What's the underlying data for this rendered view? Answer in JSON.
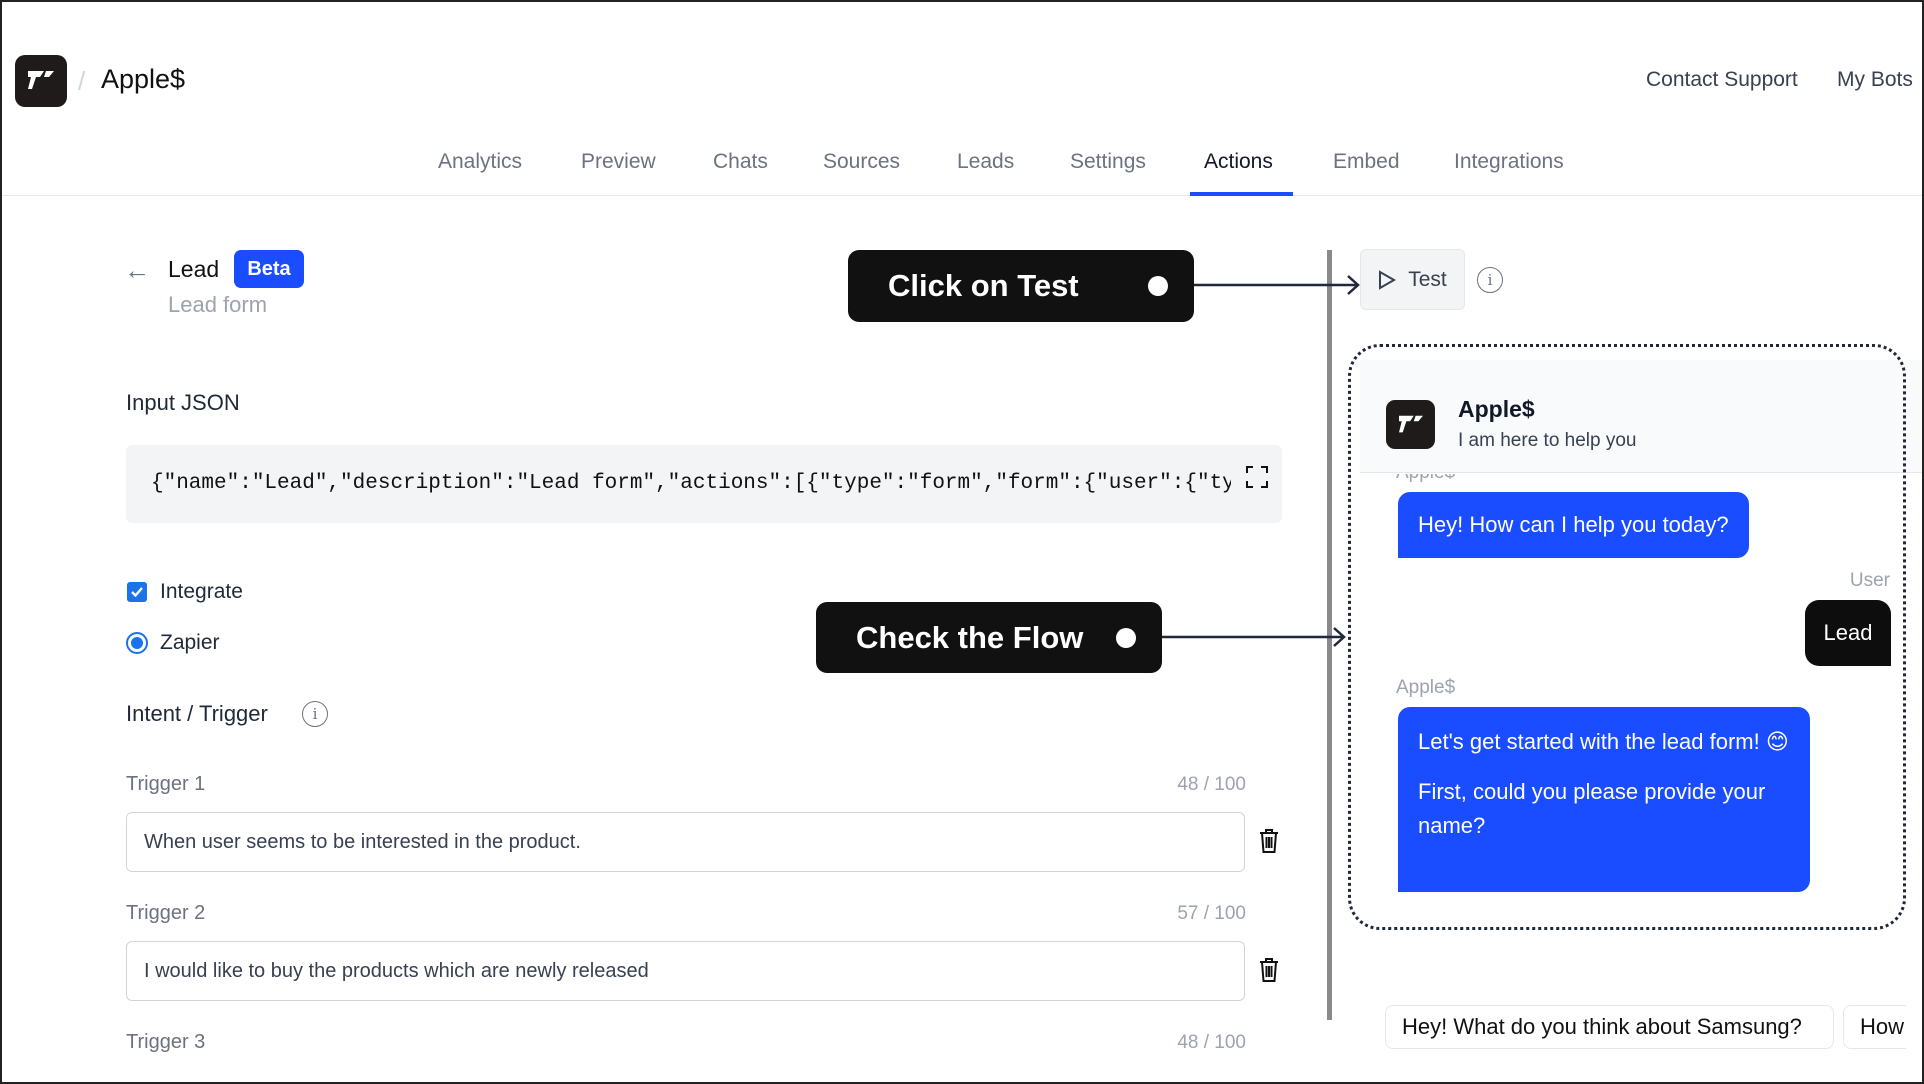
{
  "header": {
    "app_title": "Apple$",
    "separator": "/",
    "links": {
      "contact_support": "Contact Support",
      "my_bots": "My Bots"
    }
  },
  "tabs": [
    {
      "label": "Analytics"
    },
    {
      "label": "Preview"
    },
    {
      "label": "Chats"
    },
    {
      "label": "Sources"
    },
    {
      "label": "Leads"
    },
    {
      "label": "Settings"
    },
    {
      "label": "Actions",
      "active": true
    },
    {
      "label": "Embed"
    },
    {
      "label": "Integrations"
    }
  ],
  "action": {
    "title": "Lead",
    "badge": "Beta",
    "subtitle": "Lead form"
  },
  "input_json": {
    "label": "Input JSON",
    "value": "{\"name\":\"Lead\",\"description\":\"Lead form\",\"actions\":[{\"type\":\"form\",\"form\":{\"user\":{\"ty"
  },
  "integrate": {
    "label": "Integrate",
    "checked": true,
    "option": "Zapier",
    "option_selected": true
  },
  "intent": {
    "label": "Intent / Trigger"
  },
  "triggers": [
    {
      "label": "Trigger 1",
      "count": "48 / 100",
      "value": "When user seems to be interested in the product."
    },
    {
      "label": "Trigger 2",
      "count": "57 / 100",
      "value": "I would like to buy the products which are newly released"
    },
    {
      "label": "Trigger 3",
      "count": "48 / 100"
    }
  ],
  "callouts": {
    "test": "Click on Test",
    "flow": "Check the Flow"
  },
  "test_button": {
    "label": "Test"
  },
  "chat": {
    "bot_name": "Apple$",
    "bot_tagline": "I am here to help you",
    "messages": [
      {
        "sender": "Apple$",
        "text": "Hey! How can I help you today?"
      },
      {
        "sender": "User",
        "text": "Lead"
      },
      {
        "sender": "Apple$",
        "text": "Let's get started with the lead form! 😊",
        "text2": "First, could you please provide your name?"
      }
    ],
    "suggestions": [
      "Hey! What do you think about Samsung?",
      "How"
    ]
  },
  "colors": {
    "accent": "#1a4dff",
    "callout_bg": "#111111",
    "checkbox": "#1a73e8"
  }
}
